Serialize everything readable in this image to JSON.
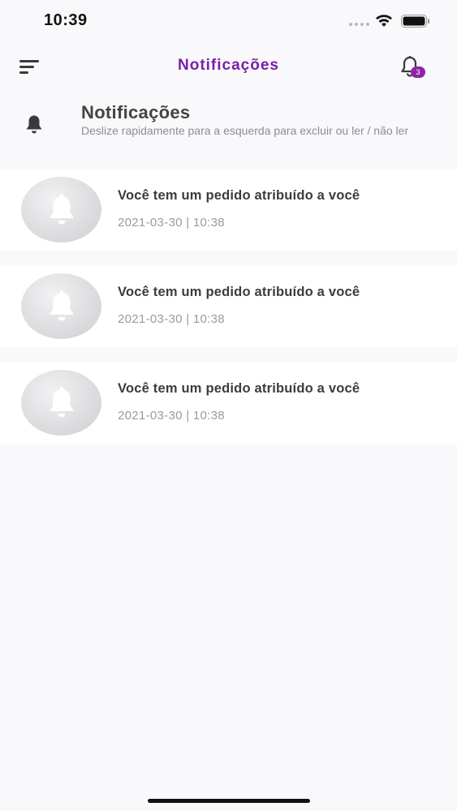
{
  "status_bar": {
    "time": "10:39"
  },
  "nav": {
    "title": "Notificações",
    "badge_count": "3",
    "menu_icon": "menu-icon",
    "bell_icon": "bell-icon"
  },
  "header": {
    "title": "Notificações",
    "subtitle": "Deslize rapidamente para a esquerda para excluir ou ler / não ler"
  },
  "notifications": [
    {
      "title": "Você tem um pedido atribuído a você",
      "date": "2021-03-30 | 10:38"
    },
    {
      "title": "Você tem um pedido atribuído a você",
      "date": "2021-03-30 | 10:38"
    },
    {
      "title": "Você tem um pedido atribuído a você",
      "date": "2021-03-30 | 10:38"
    }
  ],
  "colors": {
    "accent": "#7a1fa8",
    "badge": "#8e24aa"
  }
}
